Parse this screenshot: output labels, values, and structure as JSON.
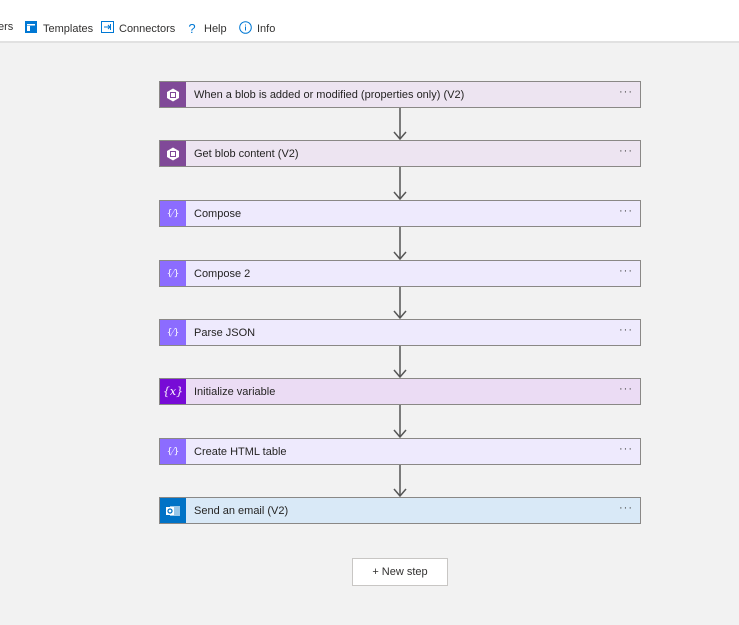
{
  "toolbar": {
    "items": [
      {
        "label": "ers",
        "icon": "truncated"
      },
      {
        "label": "Templates",
        "icon": "templates-icon"
      },
      {
        "label": "Connectors",
        "icon": "connectors-icon"
      },
      {
        "label": "Help",
        "icon": "help-icon"
      },
      {
        "label": "Info",
        "icon": "info-icon"
      }
    ]
  },
  "steps": [
    {
      "label": "When a blob is added or modified (properties only) (V2)",
      "icon": "blob-storage-icon",
      "accent": "#804998",
      "bg": "#ede4f1",
      "more": "···"
    },
    {
      "label": "Get blob content (V2)",
      "icon": "blob-storage-icon",
      "accent": "#804998",
      "bg": "#ede4f1",
      "more": "···"
    },
    {
      "label": "Compose",
      "icon": "data-operation-icon",
      "accent": "#8c6cff",
      "bg": "#eeeafd",
      "more": "···"
    },
    {
      "label": "Compose 2",
      "icon": "data-operation-icon",
      "accent": "#8c6cff",
      "bg": "#eeeafd",
      "more": "···"
    },
    {
      "label": "Parse JSON",
      "icon": "data-operation-icon",
      "accent": "#8c6cff",
      "bg": "#eeeafd",
      "more": "···"
    },
    {
      "label": "Initialize variable",
      "icon": "variable-icon",
      "accent": "#770bd6",
      "bg": "#ebdcf4",
      "more": "···"
    },
    {
      "label": "Create HTML table",
      "icon": "data-operation-icon",
      "accent": "#8c6cff",
      "bg": "#eeeafd",
      "more": "···"
    },
    {
      "label": "Send an email (V2)",
      "icon": "outlook-icon",
      "accent": "#0072c6",
      "bg": "#d9e9f7",
      "more": "···"
    }
  ],
  "new_step_label": "+ New step"
}
